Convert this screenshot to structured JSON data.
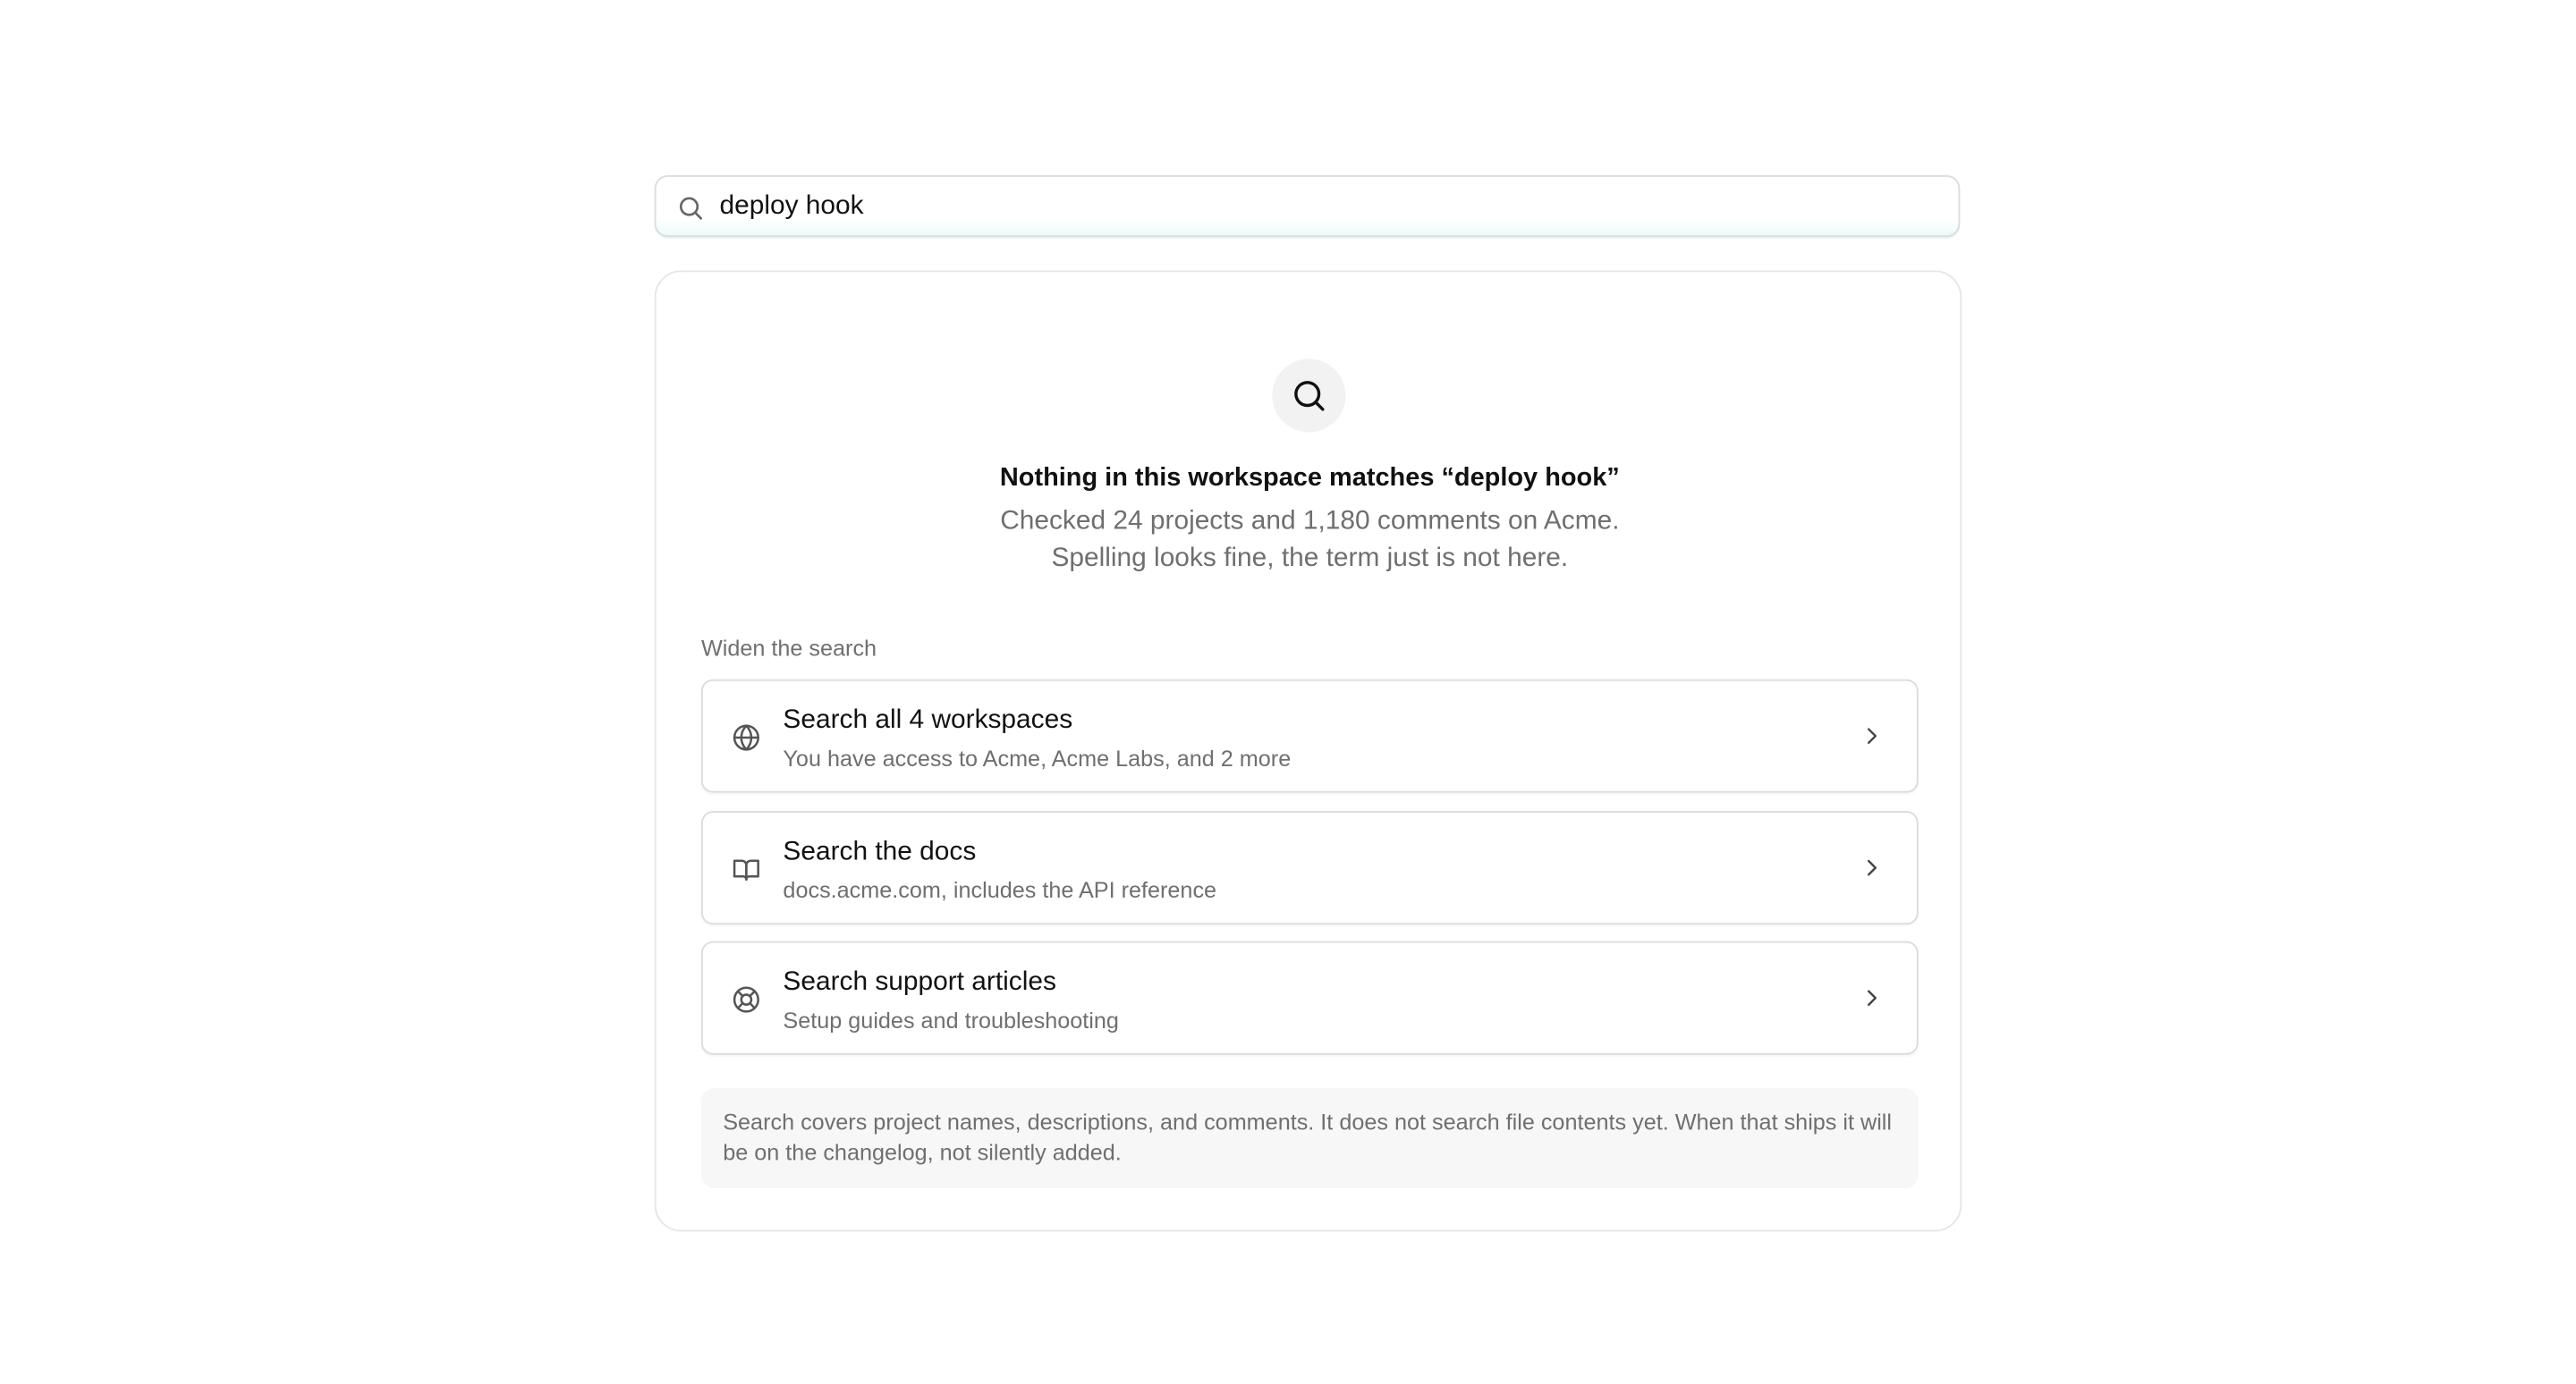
{
  "search": {
    "value": "deploy hook",
    "icon": "search-icon"
  },
  "empty_state": {
    "icon": "search-icon",
    "headline": "Nothing in this workspace matches “deploy hook”",
    "line1": "Checked 24 projects and 1,180 comments on Acme.",
    "line2": "Spelling looks fine, the term just is not here."
  },
  "widen": {
    "label": "Widen the search",
    "options": [
      {
        "icon": "globe-icon",
        "title": "Search all 4 workspaces",
        "description": "You have access to Acme, Acme Labs, and 2 more"
      },
      {
        "icon": "book-icon",
        "title": "Search the docs",
        "description": "docs.acme.com, includes the API reference"
      },
      {
        "icon": "lifebuoy-icon",
        "title": "Search support articles",
        "description": "Setup guides and troubleshooting"
      }
    ]
  },
  "note": {
    "text": "Search covers project names, descriptions, and comments. It does not search file contents yet. When that ships it will be on the changelog, not silently added."
  },
  "colors": {
    "text_primary": "#111111",
    "text_secondary": "#6f6f6f",
    "border": "#dcdcdc",
    "icon_circle_bg": "#f2f2f2",
    "note_bg": "#f7f7f7"
  }
}
